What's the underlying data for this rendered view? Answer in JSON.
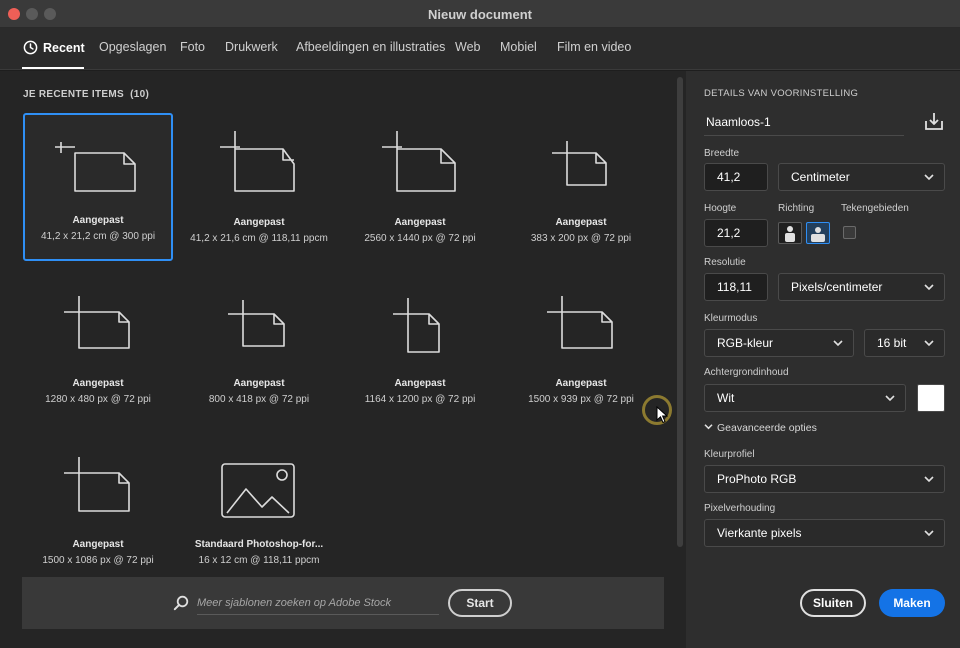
{
  "window": {
    "title": "Nieuw document"
  },
  "tabs": [
    {
      "label": "Recent"
    },
    {
      "label": "Opgeslagen"
    },
    {
      "label": "Foto"
    },
    {
      "label": "Drukwerk"
    },
    {
      "label": "Afbeeldingen en illustraties"
    },
    {
      "label": "Web"
    },
    {
      "label": "Mobiel"
    },
    {
      "label": "Film en video"
    }
  ],
  "recent": {
    "heading": "JE RECENTE ITEMS",
    "count": "(10)",
    "items": [
      {
        "name": "Aangepast",
        "dims": "41,2 x 21,2 cm @ 300 ppi"
      },
      {
        "name": "Aangepast",
        "dims": "41,2 x 21,6 cm @ 118,11 ppcm"
      },
      {
        "name": "Aangepast",
        "dims": "2560 x 1440 px @ 72 ppi"
      },
      {
        "name": "Aangepast",
        "dims": "383 x 200 px @ 72 ppi"
      },
      {
        "name": "Aangepast",
        "dims": "1280 x 480 px @ 72 ppi"
      },
      {
        "name": "Aangepast",
        "dims": "800 x 418 px @ 72 ppi"
      },
      {
        "name": "Aangepast",
        "dims": "1164 x 1200 px @ 72 ppi"
      },
      {
        "name": "Aangepast",
        "dims": "1500 x 939 px @ 72 ppi"
      },
      {
        "name": "Aangepast",
        "dims": "1500 x 1086 px @ 72 ppi"
      },
      {
        "name": "Standaard Photoshop-for...",
        "dims": "16 x 12 cm @ 118,11 ppcm"
      }
    ]
  },
  "search": {
    "placeholder": "Meer sjablonen zoeken op Adobe Stock",
    "start_label": "Start"
  },
  "details": {
    "heading": "DETAILS VAN VOORINSTELLING",
    "preset_name": "Naamloos-1",
    "width_label": "Breedte",
    "width_value": "41,2",
    "width_unit": "Centimeter",
    "height_label": "Hoogte",
    "height_value": "21,2",
    "orientation_label": "Richting",
    "artboards_label": "Tekengebieden",
    "resolution_label": "Resolutie",
    "resolution_value": "118,11",
    "resolution_unit": "Pixels/centimeter",
    "color_mode_label": "Kleurmodus",
    "color_mode": "RGB-kleur",
    "bit_depth": "16 bit",
    "background_label": "Achtergrondinhoud",
    "background": "Wit",
    "background_color": "#ffffff",
    "advanced_label": "Geavanceerde opties",
    "color_profile_label": "Kleurprofiel",
    "color_profile": "ProPhoto RGB",
    "pixel_aspect_label": "Pixelverhouding",
    "pixel_aspect": "Vierkante pixels"
  },
  "actions": {
    "close_label": "Sluiten",
    "make_label": "Maken"
  },
  "colors": {
    "accent": "#1473e6",
    "selection": "#2f8ff5",
    "close_dot": "#ee5f57"
  }
}
